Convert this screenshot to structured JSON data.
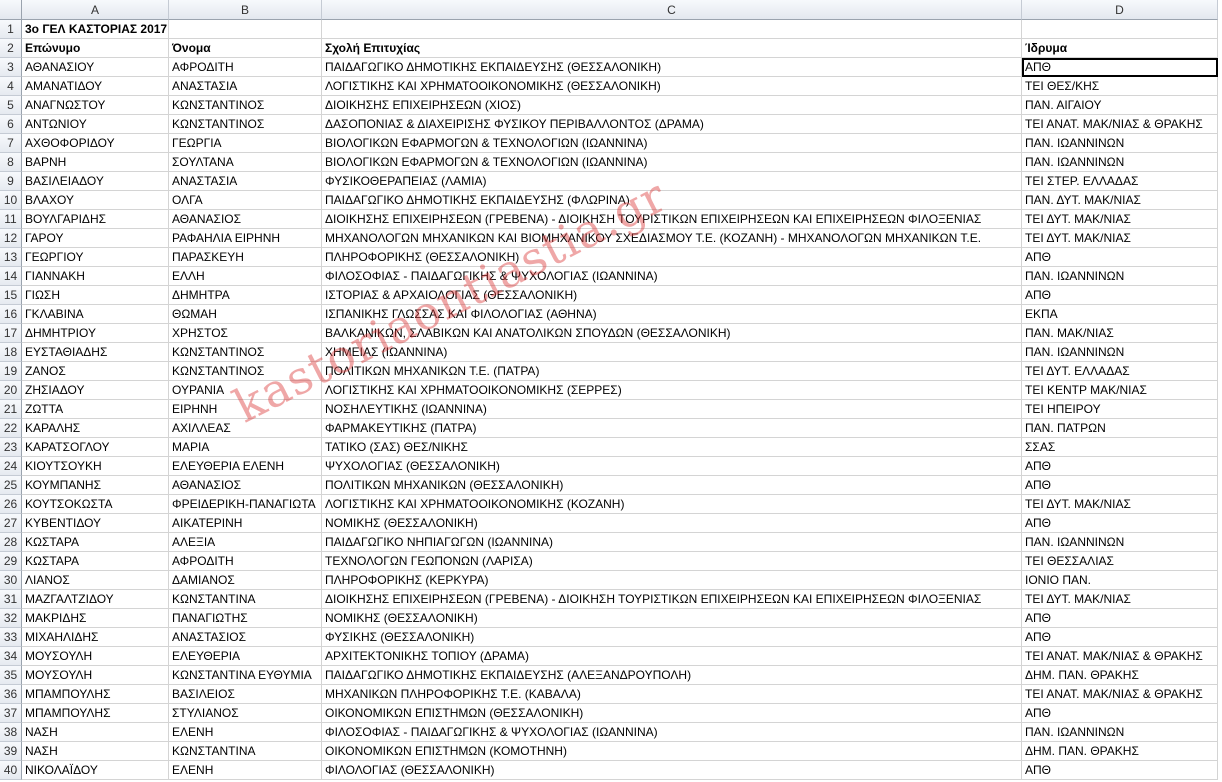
{
  "columns": [
    "A",
    "B",
    "C",
    "D"
  ],
  "watermark": "kastoriaontiastia.gr",
  "title_row": {
    "row": "1",
    "text": "3ο ΓΕΛ ΚΑΣΤΟΡΙΑΣ 2017"
  },
  "header_row": {
    "row": "2",
    "cells": [
      "Επώνυμο",
      "Όνομα",
      "Σχολή Επιτυχίας",
      "Ίδρυμα"
    ]
  },
  "rows": [
    {
      "n": "3",
      "a": "ΑΘΑΝΑΣΙΟΥ",
      "b": "ΑΦΡΟΔΙΤΗ",
      "c": "ΠΑΙΔΑΓΩΓΙΚΟ ΔΗΜΟΤΙΚΗΣ ΕΚΠΑΙΔΕΥΣΗΣ (ΘΕΣΣΑΛΟΝΙΚΗ)",
      "d": "ΑΠΘ"
    },
    {
      "n": "4",
      "a": "ΑΜΑΝΑΤΙΔΟΥ",
      "b": "ΑΝΑΣΤΑΣΙΑ",
      "c": "ΛΟΓΙΣΤΙΚΗΣ ΚΑΙ ΧΡΗΜΑΤΟΟΙΚΟΝΟΜΙΚΗΣ (ΘΕΣΣΑΛΟΝΙΚΗ)",
      "d": "ΤΕΙ ΘΕΣ/ΚΗΣ"
    },
    {
      "n": "5",
      "a": "ΑΝΑΓΝΩΣΤΟΥ",
      "b": "ΚΩΝΣΤΑΝΤΙΝΟΣ",
      "c": "ΔΙΟΙΚΗΣΗΣ ΕΠΙΧΕΙΡΗΣΕΩΝ (ΧΙΟΣ)",
      "d": "ΠΑΝ. ΑΙΓΑΙΟΥ"
    },
    {
      "n": "6",
      "a": "ΑΝΤΩΝΙΟΥ",
      "b": "ΚΩΝΣΤΑΝΤΙΝΟΣ",
      "c": "ΔΑΣΟΠΟΝΙΑΣ & ΔΙΑΧΕΙΡΙΣΗΣ ΦΥΣΙΚΟΥ ΠΕΡΙΒΑΛΛΟΝΤΟΣ (ΔΡΑΜΑ)",
      "d": "ΤΕΙ ΑΝΑΤ. ΜΑΚ/ΝΙΑΣ & ΘΡΑΚΗΣ"
    },
    {
      "n": "7",
      "a": "ΑΧΘΟΦΟΡΙΔΟΥ",
      "b": "ΓΕΩΡΓΙΑ",
      "c": "ΒΙΟΛΟΓΙΚΩΝ ΕΦΑΡΜΟΓΩΝ & ΤΕΧΝΟΛΟΓΙΩΝ (ΙΩΑΝΝΙΝΑ)",
      "d": "ΠΑΝ. ΙΩΑΝΝΙΝΩΝ"
    },
    {
      "n": "8",
      "a": "ΒΑΡΝΗ",
      "b": "ΣΟΥΛΤΑΝΑ",
      "c": "ΒΙΟΛΟΓΙΚΩΝ ΕΦΑΡΜΟΓΩΝ & ΤΕΧΝΟΛΟΓΙΩΝ (ΙΩΑΝΝΙΝΑ)",
      "d": "ΠΑΝ. ΙΩΑΝΝΙΝΩΝ"
    },
    {
      "n": "9",
      "a": "ΒΑΣΙΛΕΙΑΔΟΥ",
      "b": "ΑΝΑΣΤΑΣΙΑ",
      "c": "ΦΥΣΙΚΟΘΕΡΑΠΕΙΑΣ (ΛΑΜΙΑ)",
      "d": "ΤΕΙ  ΣΤΕΡ. ΕΛΛΑΔΑΣ"
    },
    {
      "n": "10",
      "a": "ΒΛΑΧΟΥ",
      "b": "ΟΛΓΑ",
      "c": "ΠΑΙΔΑΓΩΓΙΚΟ ΔΗΜΟΤΙΚΗΣ ΕΚΠΑΙΔΕΥΣΗΣ (ΦΛΩΡΙΝΑ)",
      "d": "ΠΑΝ. ΔΥΤ. ΜΑΚ/ΝΙΑΣ"
    },
    {
      "n": "11",
      "a": "ΒΟΥΛΓΑΡΙΔΗΣ",
      "b": "ΑΘΑΝΑΣΙΟΣ",
      "c": "ΔΙΟΙΚΗΣΗΣ ΕΠΙΧΕΙΡΗΣΕΩΝ (ΓΡΕΒΕΝΑ) - ΔΙΟΙΚΗΣΗ ΤΟΥΡΙΣΤΙΚΩΝ ΕΠΙΧΕΙΡΗΣΕΩΝ ΚΑΙ ΕΠΙΧΕΙΡΗΣΕΩΝ ΦΙΛΟΞΕΝΙΑΣ",
      "d": "ΤΕΙ ΔΥΤ. ΜΑΚ/ΝΙΑΣ"
    },
    {
      "n": "12",
      "a": "ΓΑΡΟΥ",
      "b": "ΡΑΦΑΗΛΙΑ ΕΙΡΗΝΗ",
      "c": "ΜΗΧΑΝΟΛΟΓΩΝ ΜΗΧΑΝΙΚΩΝ ΚΑΙ ΒΙΟΜΗΧΑΝΙΚΟΥ ΣΧΕΔΙΑΣΜΟΥ Τ.Ε. (ΚΟΖΑΝΗ) - ΜΗΧΑΝΟΛΟΓΩΝ ΜΗΧΑΝΙΚΩΝ Τ.Ε.",
      "d": "ΤΕΙ ΔΥΤ. ΜΑΚ/ΝΙΑΣ"
    },
    {
      "n": "13",
      "a": "ΓΕΩΡΓΙΟΥ",
      "b": "ΠΑΡΑΣΚΕΥΗ",
      "c": "ΠΛΗΡΟΦΟΡΙΚΗΣ (ΘΕΣΣΑΛΟΝΙΚΗ)",
      "d": "ΑΠΘ"
    },
    {
      "n": "14",
      "a": "ΓΙΑΝΝΑΚΗ",
      "b": "ΕΛΛΗ",
      "c": "ΦΙΛΟΣΟΦΙΑΣ - ΠΑΙΔΑΓΩΓΙΚΗΣ & ΨΥΧΟΛΟΓΙΑΣ (ΙΩΑΝΝΙΝΑ)",
      "d": "ΠΑΝ. ΙΩΑΝΝΙΝΩΝ"
    },
    {
      "n": "15",
      "a": "ΓΙΩΣΗ",
      "b": "ΔΗΜΗΤΡΑ",
      "c": "ΙΣΤΟΡΙΑΣ & ΑΡΧΑΙΟΛΟΓΙΑΣ (ΘΕΣΣΑΛΟΝΙΚΗ)",
      "d": "ΑΠΘ"
    },
    {
      "n": "16",
      "a": "ΓΚΛΑΒΙΝΑ",
      "b": "ΘΩΜΑΗ",
      "c": "ΙΣΠΑΝΙΚΗΣ ΓΛΩΣΣΑΣ ΚΑΙ ΦΙΛΟΛΟΓΙΑΣ (ΑΘΗΝΑ)",
      "d": "ΕΚΠΑ"
    },
    {
      "n": "17",
      "a": "ΔΗΜΗΤΡΙΟΥ",
      "b": "ΧΡΗΣΤΟΣ",
      "c": "ΒΑΛΚΑΝΙΚΩΝ, ΣΛΑΒΙΚΩΝ ΚΑΙ ΑΝΑΤΟΛΙΚΩΝ ΣΠΟΥΔΩΝ (ΘΕΣΣΑΛΟΝΙΚΗ)",
      "d": "ΠΑΝ. ΜΑΚ/ΝΙΑΣ"
    },
    {
      "n": "18",
      "a": "ΕΥΣΤΑΘΙΑΔΗΣ",
      "b": "ΚΩΝΣΤΑΝΤΙΝΟΣ",
      "c": "ΧΗΜΕΙΑΣ (ΙΩΑΝΝΙΝΑ)",
      "d": "ΠΑΝ. ΙΩΑΝΝΙΝΩΝ"
    },
    {
      "n": "19",
      "a": "ΖΑΝΟΣ",
      "b": "ΚΩΝΣΤΑΝΤΙΝΟΣ",
      "c": "ΠΟΛΙΤΙΚΩΝ ΜΗΧΑΝΙΚΩΝ Τ.Ε. (ΠΑΤΡΑ)",
      "d": "ΤΕΙ ΔΥΤ. ΕΛΛΑΔΑΣ"
    },
    {
      "n": "20",
      "a": "ΖΗΣΙΑΔΟΥ",
      "b": "ΟΥΡΑΝΙΑ",
      "c": "ΛΟΓΙΣΤΙΚΗΣ ΚΑΙ ΧΡΗΜΑΤΟΟΙΚΟΝΟΜΙΚΗΣ (ΣΕΡΡΕΣ)",
      "d": "ΤΕΙ ΚΕΝΤΡ ΜΑΚ/ΝΙΑΣ"
    },
    {
      "n": "21",
      "a": "ΖΩΤΤΑ",
      "b": "ΕΙΡΗΝΗ",
      "c": "ΝΟΣΗΛΕΥΤΙΚΗΣ (ΙΩΑΝΝΙΝΑ)",
      "d": "ΤΕΙ ΗΠΕΙΡΟΥ"
    },
    {
      "n": "22",
      "a": "ΚΑΡΑΛΗΣ",
      "b": "ΑΧΙΛΛΕΑΣ",
      "c": "ΦΑΡΜΑΚΕΥΤΙΚΗΣ (ΠΑΤΡΑ)",
      "d": "ΠΑΝ. ΠΑΤΡΩΝ"
    },
    {
      "n": "23",
      "a": "ΚΑΡΑΤΣΟΓΛΟΥ",
      "b": "ΜΑΡΙΑ",
      "c": "ΤΑΤΙΚΟ (ΣΑΣ) ΘΕΣ/ΝΙΚΗΣ",
      "d": "ΣΣΑΣ"
    },
    {
      "n": "24",
      "a": "ΚΙΟΥΤΣΟΥΚΗ",
      "b": "ΕΛΕΥΘΕΡΙΑ ΕΛΕΝΗ",
      "c": "ΨΥΧΟΛΟΓΙΑΣ (ΘΕΣΣΑΛΟΝΙΚΗ)",
      "d": "ΑΠΘ"
    },
    {
      "n": "25",
      "a": "ΚΟΥΜΠΑΝΗΣ",
      "b": "ΑΘΑΝΑΣΙΟΣ",
      "c": "ΠΟΛΙΤΙΚΩΝ ΜΗΧΑΝΙΚΩΝ (ΘΕΣΣΑΛΟΝΙΚΗ)",
      "d": "ΑΠΘ"
    },
    {
      "n": "26",
      "a": "ΚΟΥΤΣΟΚΩΣΤΑ",
      "b": "ΦΡΕΙΔΕΡΙΚΗ-ΠΑΝΑΓΙΩΤΑ",
      "c": "ΛΟΓΙΣΤΙΚΗΣ ΚΑΙ ΧΡΗΜΑΤΟΟΙΚΟΝΟΜΙΚΗΣ (ΚΟΖΑΝΗ)",
      "d": "ΤΕΙ ΔΥΤ. ΜΑΚ/ΝΙΑΣ"
    },
    {
      "n": "27",
      "a": "ΚΥΒΕΝΤΙΔΟΥ",
      "b": "ΑΙΚΑΤΕΡΙΝΗ",
      "c": "ΝΟΜΙΚΗΣ (ΘΕΣΣΑΛΟΝΙΚΗ)",
      "d": "ΑΠΘ"
    },
    {
      "n": "28",
      "a": "ΚΩΣΤΑΡΑ",
      "b": "ΑΛΕΞΙΑ",
      "c": "ΠΑΙΔΑΓΩΓΙΚΟ ΝΗΠΙΑΓΩΓΩΝ (ΙΩΑΝΝΙΝΑ)",
      "d": "ΠΑΝ. ΙΩΑΝΝΙΝΩΝ"
    },
    {
      "n": "29",
      "a": "ΚΩΣΤΑΡΑ",
      "b": "ΑΦΡΟΔΙΤΗ",
      "c": "ΤΕΧΝΟΛΟΓΩΝ ΓΕΩΠΟΝΩΝ (ΛΑΡΙΣΑ)",
      "d": "ΤΕΙ ΘΕΣΣΑΛΙΑΣ"
    },
    {
      "n": "30",
      "a": "ΛΙΑΝΟΣ",
      "b": "ΔΑΜΙΑΝΟΣ",
      "c": "ΠΛΗΡΟΦΟΡΙΚΗΣ (ΚΕΡΚΥΡΑ)",
      "d": "ΙΟΝΙΟ ΠΑΝ."
    },
    {
      "n": "31",
      "a": "ΜΑΖΓΑΛΤΖΙΔΟΥ",
      "b": "ΚΩΝΣΤΑΝΤΙΝΑ",
      "c": "ΔΙΟΙΚΗΣΗΣ ΕΠΙΧΕΙΡΗΣΕΩΝ (ΓΡΕΒΕΝΑ) - ΔΙΟΙΚΗΣΗ ΤΟΥΡΙΣΤΙΚΩΝ ΕΠΙΧΕΙΡΗΣΕΩΝ ΚΑΙ ΕΠΙΧΕΙΡΗΣΕΩΝ ΦΙΛΟΞΕΝΙΑΣ",
      "d": "ΤΕΙ ΔΥΤ. ΜΑΚ/ΝΙΑΣ"
    },
    {
      "n": "32",
      "a": "ΜΑΚΡΙΔΗΣ",
      "b": "ΠΑΝΑΓΙΩΤΗΣ",
      "c": "ΝΟΜΙΚΗΣ (ΘΕΣΣΑΛΟΝΙΚΗ)",
      "d": "ΑΠΘ"
    },
    {
      "n": "33",
      "a": "ΜΙΧΑΗΛΙΔΗΣ",
      "b": "ΑΝΑΣΤΑΣΙΟΣ",
      "c": "ΦΥΣΙΚΗΣ (ΘΕΣΣΑΛΟΝΙΚΗ)",
      "d": "ΑΠΘ"
    },
    {
      "n": "34",
      "a": "ΜΟΥΣΟΥΛΗ",
      "b": "ΕΛΕΥΘΕΡΙΑ",
      "c": "ΑΡΧΙΤΕΚΤΟΝΙΚΗΣ ΤΟΠΙΟΥ (ΔΡΑΜΑ)",
      "d": "ΤΕΙ ΑΝΑΤ. ΜΑΚ/ΝΙΑΣ & ΘΡΑΚΗΣ"
    },
    {
      "n": "35",
      "a": "ΜΟΥΣΟΥΛΗ",
      "b": "ΚΩΝΣΤΑΝΤΙΝΑ ΕΥΘΥΜΙΑ",
      "c": "ΠΑΙΔΑΓΩΓΙΚΟ ΔΗΜΟΤΙΚΗΣ ΕΚΠΑΙΔΕΥΣΗΣ (ΑΛΕΞΑΝΔΡΟΥΠΟΛΗ)",
      "d": "ΔΗΜ. ΠΑΝ. ΘΡΑΚΗΣ"
    },
    {
      "n": "36",
      "a": "ΜΠΑΜΠΟΥΛΗΣ",
      "b": "ΒΑΣΙΛΕΙΟΣ",
      "c": "ΜΗΧΑΝΙΚΩΝ ΠΛΗΡΟΦΟΡΙΚΗΣ Τ.Ε. (ΚΑΒΑΛΑ)",
      "d": "ΤΕΙ ΑΝΑΤ. ΜΑΚ/ΝΙΑΣ & ΘΡΑΚΗΣ"
    },
    {
      "n": "37",
      "a": "ΜΠΑΜΠΟΥΛΗΣ",
      "b": "ΣΤΥΛΙΑΝΟΣ",
      "c": "ΟΙΚΟΝΟΜΙΚΩΝ ΕΠΙΣΤΗΜΩΝ (ΘΕΣΣΑΛΟΝΙΚΗ)",
      "d": "ΑΠΘ"
    },
    {
      "n": "38",
      "a": "ΝΑΣΗ",
      "b": "ΕΛΕΝΗ",
      "c": "ΦΙΛΟΣΟΦΙΑΣ - ΠΑΙΔΑΓΩΓΙΚΗΣ & ΨΥΧΟΛΟΓΙΑΣ (ΙΩΑΝΝΙΝΑ)",
      "d": "ΠΑΝ. ΙΩΑΝΝΙΝΩΝ"
    },
    {
      "n": "39",
      "a": "ΝΑΣΗ",
      "b": "ΚΩΝΣΤΑΝΤΙΝΑ",
      "c": "ΟΙΚΟΝΟΜΙΚΩΝ ΕΠΙΣΤΗΜΩΝ (ΚΟΜΟΤΗΝΗ)",
      "d": "ΔΗΜ. ΠΑΝ. ΘΡΑΚΗΣ"
    },
    {
      "n": "40",
      "a": "ΝΙΚΟΛΑΪΔΟΥ",
      "b": "ΕΛΕΝΗ",
      "c": "ΦΙΛΟΛΟΓΙΑΣ (ΘΕΣΣΑΛΟΝΙΚΗ)",
      "d": "ΑΠΘ"
    }
  ]
}
